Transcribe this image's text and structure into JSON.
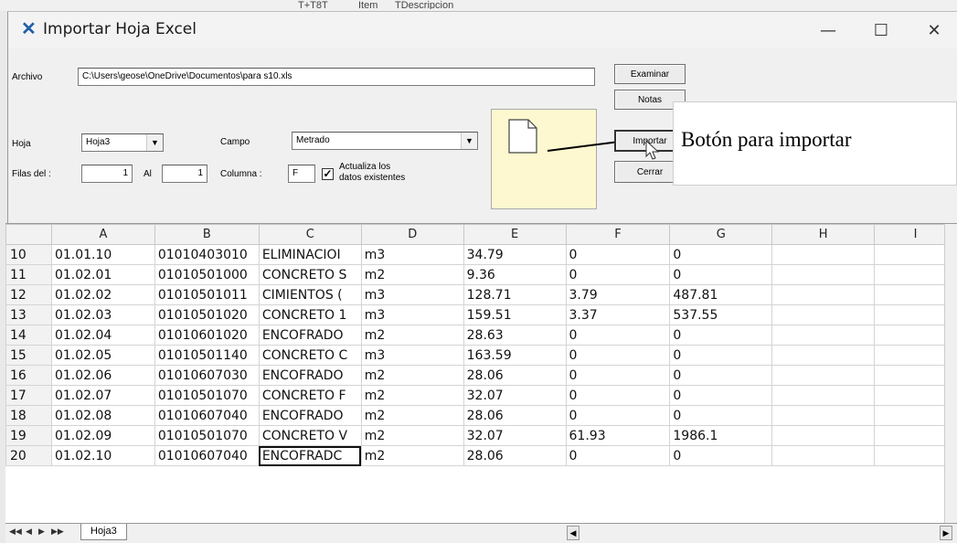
{
  "background_fragments": [
    "T+T8T",
    "Item",
    "TDescripcion"
  ],
  "window": {
    "title": "Importar Hoja Excel",
    "icon": "excel-x-icon",
    "minimize": "—",
    "maximize": "☐",
    "close": "✕"
  },
  "form": {
    "archivo_label": "Archivo",
    "archivo_value": "C:\\Users\\geose\\OneDrive\\Documentos\\para s10.xls",
    "examinar": "Examinar",
    "notas": "Notas",
    "hoja_label": "Hoja",
    "hoja_value": "Hoja3",
    "campo_label": "Campo",
    "campo_value": "Metrado",
    "importar": "Importar",
    "filas_label": "Filas del :",
    "filas_from": "1",
    "al_label": "Al",
    "filas_to": "1",
    "columna_label": "Columna :",
    "columna_value": "F",
    "checkbox_checked": true,
    "actualiza_line1": "Actualiza los",
    "actualiza_line2": "datos existentes",
    "cerrar": "Cerrar"
  },
  "annotation": {
    "text": "Botón para importar"
  },
  "grid": {
    "columns": [
      "",
      "A",
      "B",
      "C",
      "D",
      "E",
      "F",
      "G",
      "H",
      "I"
    ],
    "rows": [
      [
        "10",
        "01.01.10",
        "01010403010",
        "ELIMINACIOI",
        "m3",
        "34.79",
        "0",
        "0",
        "",
        ""
      ],
      [
        "11",
        "01.02.01",
        "01010501000",
        "CONCRETO S",
        "m2",
        "9.36",
        "0",
        "0",
        "",
        ""
      ],
      [
        "12",
        "01.02.02",
        "01010501011",
        "CIMIENTOS (",
        "m3",
        "128.71",
        "3.79",
        "487.81",
        "",
        ""
      ],
      [
        "13",
        "01.02.03",
        "01010501020",
        "CONCRETO 1",
        "m3",
        "159.51",
        "3.37",
        "537.55",
        "",
        ""
      ],
      [
        "14",
        "01.02.04",
        "01010601020",
        "ENCOFRADO",
        "m2",
        "28.63",
        "0",
        "0",
        "",
        ""
      ],
      [
        "15",
        "01.02.05",
        "01010501140",
        "CONCRETO C",
        "m3",
        "163.59",
        "0",
        "0",
        "",
        ""
      ],
      [
        "16",
        "01.02.06",
        "01010607030",
        "ENCOFRADO",
        "m2",
        "28.06",
        "0",
        "0",
        "",
        ""
      ],
      [
        "17",
        "01.02.07",
        "01010501070",
        "CONCRETO F",
        "m2",
        "32.07",
        "0",
        "0",
        "",
        ""
      ],
      [
        "18",
        "01.02.08",
        "01010607040",
        "ENCOFRADO",
        "m2",
        "28.06",
        "0",
        "0",
        "",
        ""
      ],
      [
        "19",
        "01.02.09",
        "01010501070",
        "CONCRETO V",
        "m2",
        "32.07",
        "61.93",
        "1986.1",
        "",
        ""
      ],
      [
        "20",
        "01.02.10",
        "01010607040",
        "ENCOFRADC",
        "m2",
        "28.06",
        "0",
        "0",
        "",
        ""
      ]
    ],
    "selected_cell": "C20"
  },
  "sheet_tabs": {
    "nav": [
      "◀◀",
      "◀",
      "▶",
      "▶▶"
    ],
    "active": "Hoja3"
  }
}
